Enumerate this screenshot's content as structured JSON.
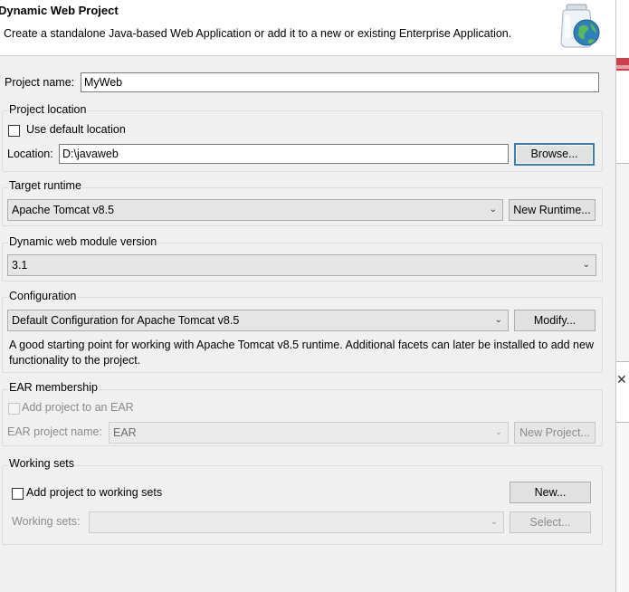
{
  "header": {
    "title": "Dynamic Web Project",
    "description": "Create a standalone Java-based Web Application or add it to a new or existing Enterprise Application.",
    "icon": "globe-jar-icon"
  },
  "project_name": {
    "label": "Project name:",
    "value": "MyWeb"
  },
  "project_location": {
    "group_label": "Project location",
    "use_default_label": "Use default location",
    "use_default_checked": false,
    "location_label": "Location:",
    "location_value": "D:\\javaweb",
    "browse_label": "Browse..."
  },
  "target_runtime": {
    "group_label": "Target runtime",
    "selected": "Apache Tomcat v8.5",
    "new_runtime_label": "New Runtime..."
  },
  "web_module": {
    "group_label": "Dynamic web module version",
    "selected": "3.1"
  },
  "configuration": {
    "group_label": "Configuration",
    "selected": "Default Configuration for Apache Tomcat v8.5",
    "modify_label": "Modify...",
    "description": "A good starting point for working with Apache Tomcat v8.5 runtime. Additional facets can later be installed to add new functionality to the project."
  },
  "ear": {
    "group_label": "EAR membership",
    "add_label": "Add project to an EAR",
    "name_label": "EAR project name:",
    "name_value": "EAR",
    "new_project_label": "New Project..."
  },
  "working_sets": {
    "group_label": "Working sets",
    "add_label": "Add project to working sets",
    "new_label": "New...",
    "sets_label": "Working sets:",
    "sets_value": "",
    "select_label": "Select..."
  },
  "colors": {
    "focus_border": "#3c7fb1",
    "disabled_text": "#8b8b8b"
  }
}
